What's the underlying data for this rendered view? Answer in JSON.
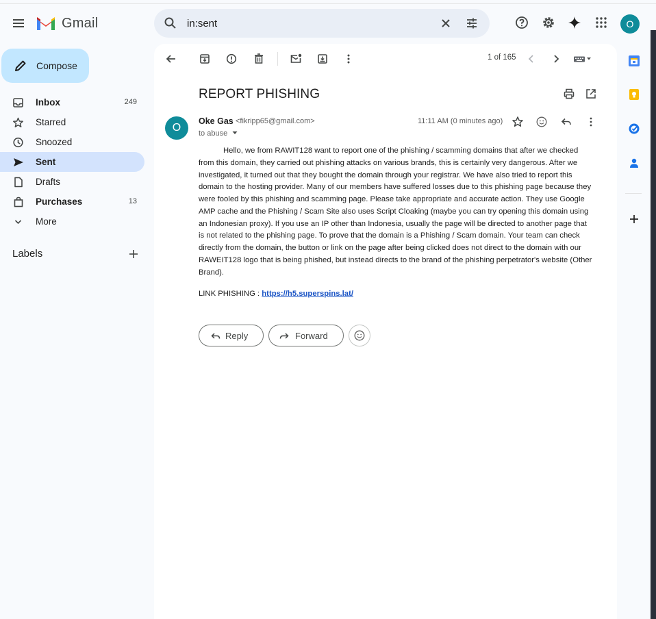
{
  "app": {
    "name": "Gmail"
  },
  "search": {
    "value": "in:sent"
  },
  "sidebar": {
    "compose_label": "Compose",
    "items": [
      {
        "label": "Inbox",
        "count": "249",
        "bold": true,
        "active": false,
        "icon": "inbox-icon"
      },
      {
        "label": "Starred",
        "count": "",
        "bold": false,
        "active": false,
        "icon": "star-icon"
      },
      {
        "label": "Snoozed",
        "count": "",
        "bold": false,
        "active": false,
        "icon": "clock-icon"
      },
      {
        "label": "Sent",
        "count": "",
        "bold": true,
        "active": true,
        "icon": "send-icon"
      },
      {
        "label": "Drafts",
        "count": "",
        "bold": false,
        "active": false,
        "icon": "draft-icon"
      },
      {
        "label": "Purchases",
        "count": "13",
        "bold": true,
        "active": false,
        "icon": "shopping-bag-icon"
      },
      {
        "label": "More",
        "count": "",
        "bold": false,
        "active": false,
        "icon": "chevron-down-icon"
      }
    ],
    "labels_title": "Labels"
  },
  "header": {
    "avatar_letter": "O"
  },
  "toolbar": {
    "pager": "1 of 165"
  },
  "message": {
    "subject": "REPORT PHISHING",
    "sender_initial": "O",
    "sender_name": "Oke Gas",
    "sender_email": "<fikripp65@gmail.com>",
    "to_line": "to abuse",
    "timestamp": "11:11 AM (0 minutes ago)",
    "body": "Hello, we from RAWIT128 want to report one of the phishing / scamming domains that after we checked from this domain, they carried out phishing attacks on various brands, this is certainly very dangerous. After we investigated, it turned out that they bought the domain through your registrar. We have also tried to report this domain to the hosting provider. Many of our members have suffered losses due to this phishing page because they were fooled by this phishing and scamming page. Please take appropriate and accurate action. They use Google AMP cache and the Phishing / Scam Site also uses Script Cloaking (maybe you can try opening this domain using an Indonesian proxy). If you use an IP other than Indonesia, usually the page will be directed to another page that is not related to the phishing page. To prove that the domain is a Phishing / Scam domain. Your team can check directly from the domain, the button or link on the page after being clicked does not direct to the domain with our RAWEIT128 logo that is being phished, but instead directs to the brand of the phishing perpetrator's website (Other Brand).",
    "link_label": "LINK PHISHING : ",
    "link_url": "https://h5.superspins.lat/",
    "reply_label": "Reply",
    "forward_label": "Forward"
  },
  "colors": {
    "compose_bg": "#c2e7ff",
    "active_nav_bg": "#d3e3fd",
    "avatar_bg": "#0f8c9a",
    "link": "#1a54c5",
    "search_bg": "#e9eef6"
  }
}
